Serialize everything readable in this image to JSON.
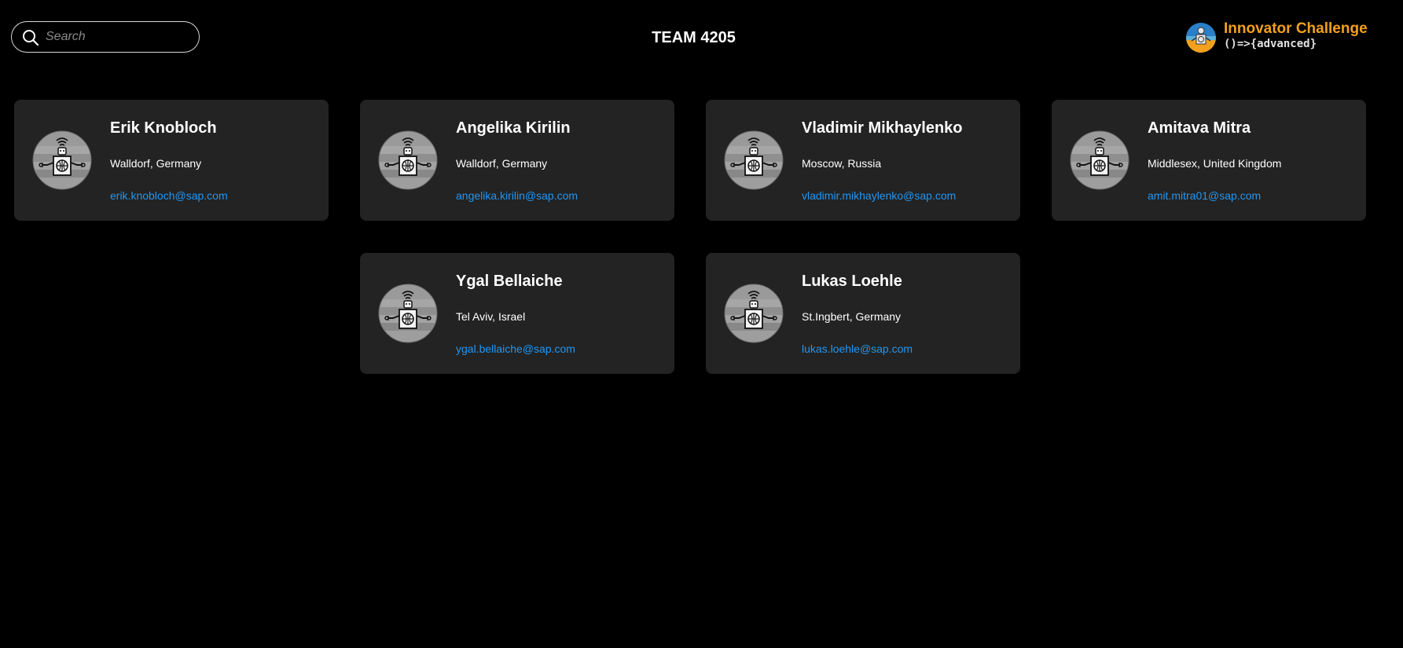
{
  "search": {
    "placeholder": "Search",
    "icon": "search-icon"
  },
  "team": {
    "title": "TEAM 4205"
  },
  "logo": {
    "line1": "Innovator Challenge",
    "line2": "()=>{advanced}",
    "accent_color": "#f2a01e"
  },
  "colors": {
    "background": "#000000",
    "card": "#232323",
    "link": "#2196f3",
    "text": "#ffffff"
  },
  "members": [
    {
      "name": "Erik Knobloch",
      "location": "Walldorf, Germany",
      "email": "erik.knobloch@sap.com",
      "avatar": "robot-avatar-icon"
    },
    {
      "name": "Angelika Kirilin",
      "location": "Walldorf, Germany",
      "email": "angelika.kirilin@sap.com",
      "avatar": "robot-avatar-icon"
    },
    {
      "name": "Vladimir Mikhaylenko",
      "location": "Moscow, Russia",
      "email": "vladimir.mikhaylenko@sap.com",
      "avatar": "robot-avatar-icon"
    },
    {
      "name": "Amitava Mitra",
      "location": "Middlesex, United Kingdom",
      "email": "amit.mitra01@sap.com",
      "avatar": "robot-avatar-icon"
    },
    {
      "name": "Ygal Bellaiche",
      "location": "Tel Aviv, Israel",
      "email": "ygal.bellaiche@sap.com",
      "avatar": "robot-avatar-icon"
    },
    {
      "name": "Lukas Loehle",
      "location": "St.Ingbert, Germany",
      "email": "lukas.loehle@sap.com",
      "avatar": "robot-avatar-icon"
    }
  ]
}
